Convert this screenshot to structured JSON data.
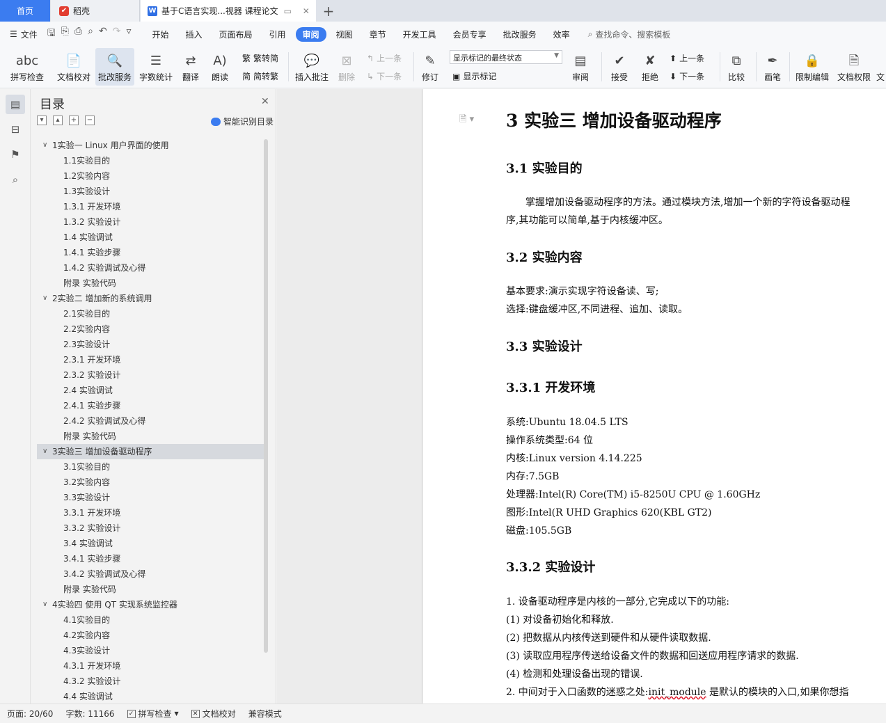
{
  "tabs": {
    "home": "首页",
    "daoke": "稻壳",
    "document": "基于C语言实现...视器 课程论文",
    "add": "+"
  },
  "menubar": {
    "file": "文件",
    "items": [
      "开始",
      "插入",
      "页面布局",
      "引用",
      "审阅",
      "视图",
      "章节",
      "开发工具",
      "会员专享",
      "批改服务",
      "效率"
    ],
    "active": "审阅",
    "search": "查找命令、搜索模板"
  },
  "ribbon": {
    "spell_check": "拼写检查",
    "doc_proof": "文档校对",
    "correction_service": "批改服务",
    "word_count": "字数统计",
    "translate": "翻译",
    "read_aloud": "朗读",
    "trad_to_simp": "繁转简",
    "simp_to_trad": "简转繁",
    "insert_comment": "插入批注",
    "delete": "删除",
    "prev": "上一条",
    "next": "下一条",
    "revise": "修订",
    "markup_state": "显示标记的最终状态",
    "show_markup": "显示标记",
    "review": "审阅",
    "accept": "接受",
    "reject": "拒绝",
    "prev2": "上一条",
    "next2": "下一条",
    "compare": "比较",
    "pen": "画笔",
    "restrict_edit": "限制编辑",
    "doc_permission": "文档权限",
    "more": "文"
  },
  "toc": {
    "title": "目录",
    "smart": "智能识别目录",
    "items": [
      {
        "level": 1,
        "text": "1实验一  Linux 用户界面的使用"
      },
      {
        "level": 2,
        "text": "1.1实验目的"
      },
      {
        "level": 2,
        "text": "1.2实验内容"
      },
      {
        "level": 2,
        "text": "1.3实验设计"
      },
      {
        "level": 2,
        "text": "1.3.1  开发环境"
      },
      {
        "level": 2,
        "text": "1.3.2  实验设计"
      },
      {
        "level": 2,
        "text": "1.4  实验调试"
      },
      {
        "level": 2,
        "text": "1.4.1  实验步骤"
      },
      {
        "level": 2,
        "text": "1.4.2  实验调试及心得"
      },
      {
        "level": 2,
        "text": "附录  实验代码"
      },
      {
        "level": 1,
        "text": "2实验二  增加新的系统调用"
      },
      {
        "level": 2,
        "text": "2.1实验目的"
      },
      {
        "level": 2,
        "text": "2.2实验内容"
      },
      {
        "level": 2,
        "text": "2.3实验设计"
      },
      {
        "level": 2,
        "text": "2.3.1  开发环境"
      },
      {
        "level": 2,
        "text": "2.3.2  实验设计"
      },
      {
        "level": 2,
        "text": "2.4  实验调试"
      },
      {
        "level": 2,
        "text": "2.4.1  实验步骤"
      },
      {
        "level": 2,
        "text": "2.4.2  实验调试及心得"
      },
      {
        "level": 2,
        "text": "附录  实验代码"
      },
      {
        "level": 1,
        "text": "3实验三  增加设备驱动程序",
        "selected": true
      },
      {
        "level": 2,
        "text": "3.1实验目的"
      },
      {
        "level": 2,
        "text": "3.2实验内容"
      },
      {
        "level": 2,
        "text": "3.3实验设计"
      },
      {
        "level": 2,
        "text": "3.3.1  开发环境"
      },
      {
        "level": 2,
        "text": "3.3.2  实验设计"
      },
      {
        "level": 2,
        "text": "3.4  实验调试"
      },
      {
        "level": 2,
        "text": "3.4.1  实验步骤"
      },
      {
        "level": 2,
        "text": "3.4.2  实验调试及心得"
      },
      {
        "level": 2,
        "text": "附录  实验代码"
      },
      {
        "level": 1,
        "text": "4实验四  使用 QT 实现系统监控器"
      },
      {
        "level": 2,
        "text": "4.1实验目的"
      },
      {
        "level": 2,
        "text": "4.2实验内容"
      },
      {
        "level": 2,
        "text": "4.3实验设计"
      },
      {
        "level": 2,
        "text": "4.3.1  开发环境"
      },
      {
        "level": 2,
        "text": "4.3.2  实验设计"
      },
      {
        "level": 2,
        "text": "4.4  实验调试"
      }
    ]
  },
  "doc": {
    "h1": "3  实验三  增加设备驱动程序",
    "s31": "3.1 实验目的",
    "p31a": "掌握增加设备驱动程序的方法。通过模块方法,增加一个新的字符设备驱动程",
    "p31b": "序,其功能可以简单,基于内核缓冲区。",
    "s32": "3.2 实验内容",
    "p32a": "基本要求:演示实现字符设备读、写;",
    "p32b": "选择:键盘缓冲区,不同进程、追加、读取。",
    "s33": "3.3 实验设计",
    "s331": "3.3.1   开发环境",
    "env": [
      "系统:Ubuntu 18.04.5 LTS",
      "操作系统类型:64 位",
      "内核:Linux version 4.14.225",
      "内存:7.5GB",
      "处理器:Intel(R) Core(TM) i5-8250U CPU @ 1.60GHz",
      "图形:Intel(R UHD Graphics 620(KBL GT2)",
      "磁盘:105.5GB"
    ],
    "s332": "3.3.2   实验设计",
    "list": [
      "1.  设备驱动程序是内核的一部分,它完成以下的功能:",
      "(1)  对设备初始化和释放.",
      "(2)  把数据从内核传送到硬件和从硬件读取数据.",
      "(3)  读取应用程序传送给设备文件的数据和回送应用程序请求的数据.",
      "(4)  检测和处理设备出现的错误."
    ],
    "last_pre": "2.  中间对于入口函数的迷惑之处:",
    "last_code": "init_module",
    "last_post": " 是默认的模块的入口,如果你想指"
  },
  "status": {
    "page": "页面: 20/60",
    "words": "字数: 11166",
    "spell": "拼写检查",
    "proof": "文档校对",
    "compat": "兼容模式"
  }
}
